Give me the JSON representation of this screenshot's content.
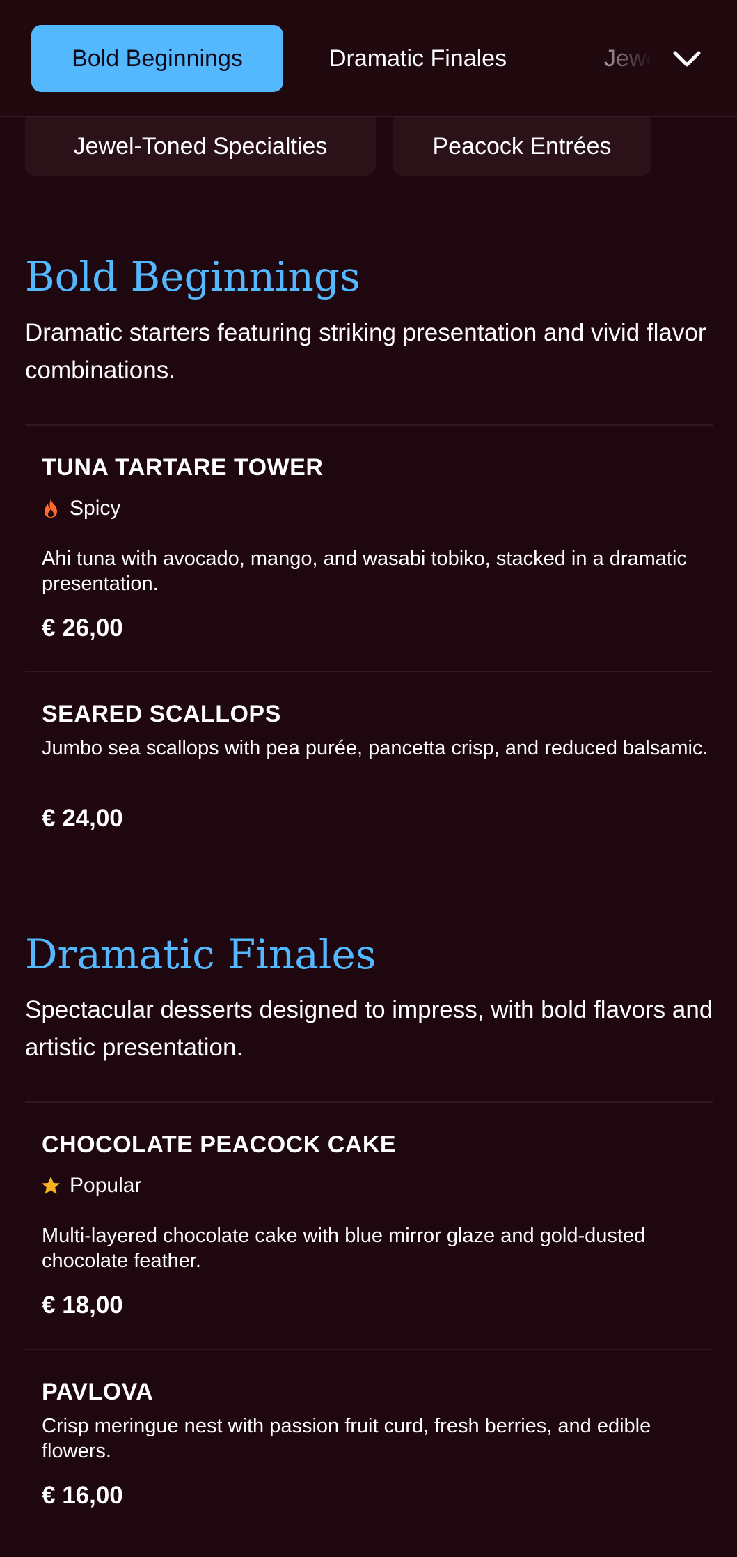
{
  "nav": {
    "tabs": [
      {
        "label": "Bold Beginnings",
        "active": true
      },
      {
        "label": "Dramatic Finales",
        "active": false
      },
      {
        "label": "Jewel-Toned Specialties",
        "active": false
      }
    ],
    "overflow_tabs": [
      "Jewel-Toned Specialties",
      "Peacock Entrées"
    ],
    "expand_icon": "chevron-down-icon"
  },
  "colors": {
    "background": "#1f0710",
    "accent": "#54b8ff",
    "spicy": "#ff6a2b",
    "popular": "#f5b324"
  },
  "sections": [
    {
      "title": "Bold Beginnings",
      "description": "Dramatic starters featuring striking presentation and vivid flavor combinations.",
      "items": [
        {
          "name": "TUNA TARTARE TOWER",
          "badge": "Spicy",
          "badge_icon": "flame-icon",
          "description": "Ahi tuna with avocado, mango, and wasabi tobiko, stacked in a dramatic presentation.",
          "price": "€ 26,00"
        },
        {
          "name": "SEARED SCALLOPS",
          "description": "Jumbo sea scallops with pea purée, pancetta crisp, and reduced balsamic.",
          "price": "€ 24,00"
        }
      ]
    },
    {
      "title": "Dramatic Finales",
      "description": "Spectacular desserts designed to impress, with bold flavors and artistic presentation.",
      "items": [
        {
          "name": "CHOCOLATE PEACOCK CAKE",
          "badge": "Popular",
          "badge_icon": "star-icon",
          "description": "Multi-layered chocolate cake with blue mirror glaze and gold-dusted chocolate feather.",
          "price": "€ 18,00"
        },
        {
          "name": "PAVLOVA",
          "description": "Crisp meringue nest with passion fruit curd, fresh berries, and edible flowers.",
          "price": "€ 16,00"
        }
      ]
    }
  ]
}
